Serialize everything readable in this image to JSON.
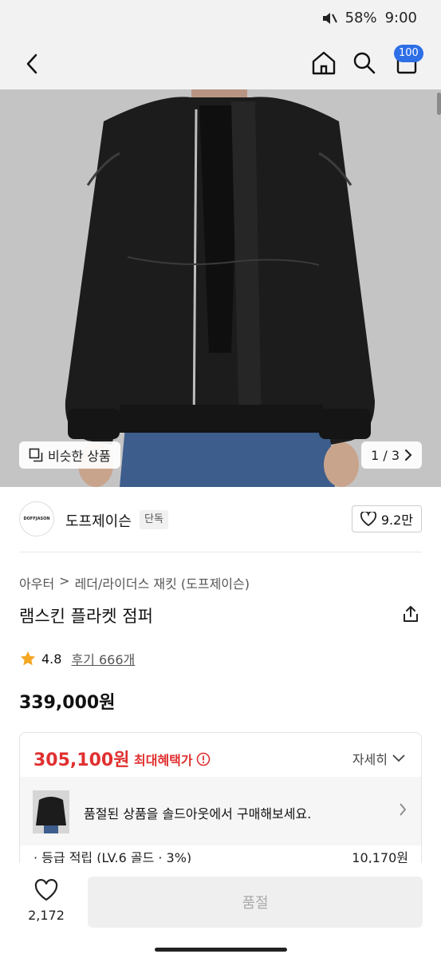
{
  "status_bar": {
    "battery": "58%",
    "time": "9:00"
  },
  "header": {
    "cart_count": "100"
  },
  "gallery": {
    "similar_label": "비슷한 상품",
    "page_indicator": "1 / 3"
  },
  "brand": {
    "logo_text": "DOFFJASON",
    "name": "도프제이슨",
    "badge": "단독",
    "likes": "9.2만"
  },
  "breadcrumb": [
    "아우터",
    ">",
    "레더/라이더스 재킷 (도프제이슨)"
  ],
  "product": {
    "title": "램스킨 플라켓 점퍼",
    "rating": "4.8",
    "review_label": "후기 666개",
    "price": "339,000원"
  },
  "benefit": {
    "price": "305,100원",
    "label": "최대혜택가",
    "detail_label": "자세히",
    "soldout_message": "품절된 상품을 솔드아웃에서 구매해보세요.",
    "points_label": "· 등급 적립 (LV.6 골드 · 3%)",
    "points_value": "10,170원"
  },
  "bottom_bar": {
    "wish_count": "2,172",
    "cta_label": "품절"
  },
  "colors": {
    "accent_red": "#e03030",
    "badge_blue": "#2e6ee6",
    "star": "#f5a623"
  }
}
